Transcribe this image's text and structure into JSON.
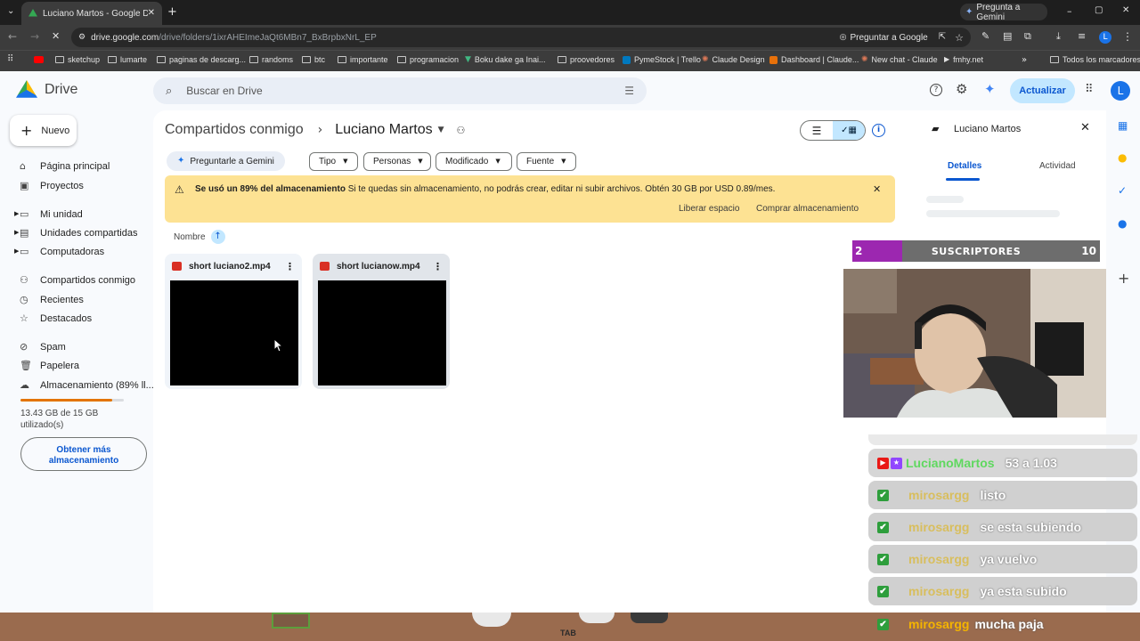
{
  "browser": {
    "tab_title": "Luciano Martos - Google Drive",
    "gemini_button": "Pregunta a Gemini",
    "url_domain": "drive.google.com",
    "url_path": "/drive/folders/1ixrAHEImeJaQt6MBn7_BxBrpbxNrL_EP",
    "omnibox_gemini": "Preguntar a Google",
    "profile_letter": "L",
    "bookmarks": [
      "sketchup",
      "lumarte",
      "paginas de descarg...",
      "randoms",
      "btc",
      "importante",
      "programacion",
      "Boku dake ga Inai...",
      "proovedores",
      "PymeStock | Trello",
      "Claude Design",
      "Dashboard | Claude...",
      "New chat - Claude",
      "fmhy.net"
    ],
    "all_bookmarks": "Todos los marcadores"
  },
  "drive": {
    "logo": "Drive",
    "search_placeholder": "Buscar en Drive",
    "update_button": "Actualizar",
    "avatar_letter": "L",
    "new_button": "Nuevo",
    "nav": [
      "Página principal",
      "Proyectos",
      "Mi unidad",
      "Unidades compartidas",
      "Computadoras",
      "Compartidos conmigo",
      "Recientes",
      "Destacados",
      "Spam",
      "Papelera",
      "Almacenamiento (89% ll..."
    ],
    "storage_used_fraction": 0.89,
    "storage_text": "13.43 GB de 15 GB utilizado(s)",
    "get_more": "Obtener más almacenamiento",
    "breadcrumb_parent": "Compartidos conmigo",
    "breadcrumb_current": "Luciano Martos",
    "gemini_chip": "Preguntarle a Gemini",
    "filters": [
      "Tipo",
      "Personas",
      "Modificado",
      "Fuente"
    ],
    "banner": {
      "bold": "Se usó un 89% del almacenamiento",
      "text": "Si te quedas sin almacenamiento, no podrás crear, editar ni subir archivos. Obtén 30 GB por USD 0.89/mes.",
      "free_space": "Liberar espacio",
      "buy": "Comprar almacenamiento"
    },
    "sort_label": "Nombre",
    "files": [
      {
        "name": "short luciano2.mp4"
      },
      {
        "name": "short lucianow.mp4"
      }
    ],
    "details": {
      "title": "Luciano Martos",
      "tab_details": "Detalles",
      "tab_activity": "Actividad"
    }
  },
  "overlay": {
    "sub_left": "2",
    "sub_label": "SUSCRIPTORES",
    "sub_right": "10",
    "chat": [
      {
        "user": "LucianoMartos",
        "text": "53 a 1.03"
      },
      {
        "user": "mirosargg",
        "text": "listo"
      },
      {
        "user": "mirosargg",
        "text": "se esta subiendo"
      },
      {
        "user": "mirosargg",
        "text": "ya vuelvo"
      },
      {
        "user": "mirosargg",
        "text": "ya esta subido"
      },
      {
        "user": "mirosargg",
        "text": "mucha paja"
      }
    ],
    "tab_key": "TAB"
  },
  "colors": {
    "accent": "#0b57d0",
    "banner": "#fde293",
    "sub_bar": "#9c27b0"
  }
}
